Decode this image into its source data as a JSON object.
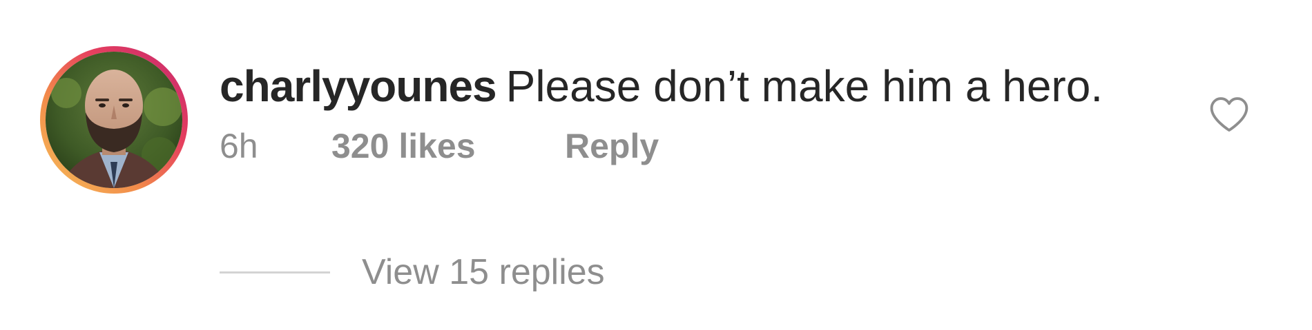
{
  "comment": {
    "username": "charlyyounes",
    "text": "Please don’t make him a hero.",
    "time": "6h",
    "likes": "320 likes",
    "reply_label": "Reply",
    "view_replies": "View 15 replies"
  },
  "icons": {
    "like": "heart-outline-icon",
    "avatar": "profile-photo"
  },
  "colors": {
    "text_primary": "#262626",
    "text_secondary": "#8e8e8e",
    "ring_gradient": [
      "#f6c15b",
      "#f28b4a",
      "#e6405e",
      "#c4266f"
    ]
  }
}
